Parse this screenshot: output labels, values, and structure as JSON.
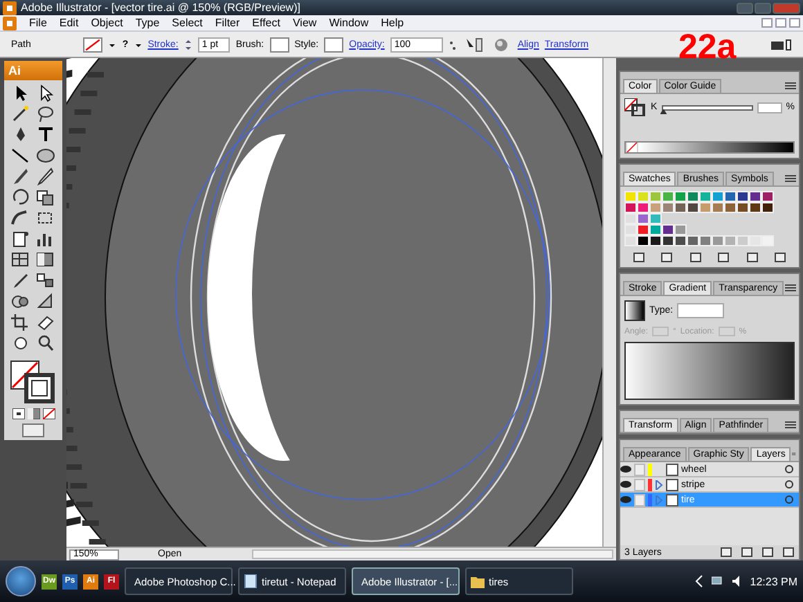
{
  "window": {
    "title": "Adobe Illustrator - [vector tire.ai @ 150% (RGB/Preview)]"
  },
  "menu": [
    "File",
    "Edit",
    "Object",
    "Type",
    "Select",
    "Filter",
    "Effect",
    "View",
    "Window",
    "Help"
  ],
  "control_bar": {
    "selection": "Path",
    "fill_glyph": "?",
    "stroke_label": "Stroke:",
    "stroke_weight": "1 pt",
    "brush_label": "Brush:",
    "style_label": "Style:",
    "opacity_label": "Opacity:",
    "opacity_value": "100",
    "links": [
      "Align",
      "Transform"
    ]
  },
  "overlay_label": "22a",
  "tools_panel": {
    "badge": "Ai"
  },
  "color_panel": {
    "tabs": [
      {
        "label": "Color",
        "selected": true
      },
      {
        "label": "Color Guide",
        "selected": false
      }
    ],
    "channel": "K",
    "level": 0,
    "unit": "%"
  },
  "swatches_panel": {
    "tabs": [
      {
        "label": "Swatches",
        "selected": true
      },
      {
        "label": "Brushes",
        "selected": false
      },
      {
        "label": "Symbols",
        "selected": false
      }
    ],
    "rows": [
      [
        {
          "color": "#f2e400"
        },
        {
          "color": "#d9e21c"
        },
        {
          "color": "#9cc63b"
        },
        {
          "color": "#4bb447"
        },
        {
          "color": "#13a14a"
        },
        {
          "color": "#0f8a5b"
        },
        {
          "color": "#17b29a"
        },
        {
          "color": "#14a0d0"
        },
        {
          "color": "#2467b1"
        },
        {
          "color": "#2b3990"
        },
        {
          "color": "#662d91"
        },
        {
          "color": "#9e1f63"
        }
      ],
      [
        {
          "color": "#d4145a"
        },
        {
          "color": "#ed1e79"
        },
        {
          "color": "#c7a27c"
        },
        {
          "color": "#9b8579"
        },
        {
          "color": "#736357"
        },
        {
          "color": "#534741"
        },
        {
          "color": "#c69c6d"
        },
        {
          "color": "#a67c52"
        },
        {
          "color": "#8c6239"
        },
        {
          "color": "#754c24"
        },
        {
          "color": "#603813"
        },
        {
          "color": "#42210b"
        }
      ],
      [
        {
          "color": "#e0e0e0"
        },
        {
          "color": "#9966cc"
        },
        {
          "color": "#33bbbb"
        }
      ],
      [
        {
          "color": "#e0e0e0"
        },
        {
          "color": "#ee1c25"
        },
        {
          "color": "#00a99d"
        },
        {
          "color": "#662d91"
        },
        {
          "color": "#999999"
        }
      ],
      [
        {
          "color": "#e0e0e0"
        },
        {
          "color": "#000000"
        },
        {
          "color": "#1a1a1a"
        },
        {
          "color": "#333333"
        },
        {
          "color": "#4d4d4d"
        },
        {
          "color": "#666666"
        },
        {
          "color": "#808080"
        },
        {
          "color": "#999999"
        },
        {
          "color": "#b3b3b3"
        },
        {
          "color": "#cccccc"
        },
        {
          "color": "#e6e6e6"
        },
        {
          "color": "#f2f2f2"
        }
      ]
    ]
  },
  "gradient_panel": {
    "tabs": [
      {
        "label": "Stroke",
        "selected": false
      },
      {
        "label": "Gradient",
        "selected": true
      },
      {
        "label": "Transparency",
        "selected": false
      }
    ],
    "type_label": "Type:",
    "angle_label": "Angle:",
    "angle_unit": "°",
    "location_label": "Location:",
    "location_unit": "%"
  },
  "transform_panel": {
    "tabs": [
      {
        "label": "Transform",
        "selected": true
      },
      {
        "label": "Align",
        "selected": false
      },
      {
        "label": "Pathfinder",
        "selected": false
      }
    ]
  },
  "layers_panel": {
    "tabs": [
      {
        "label": "Appearance",
        "selected": false
      },
      {
        "label": "Graphic Sty",
        "selected": false
      },
      {
        "label": "Layers",
        "selected": true
      }
    ],
    "layers": [
      {
        "name": "wheel",
        "color": "#ffff00",
        "expandable": false,
        "selected": false
      },
      {
        "name": "stripe",
        "color": "#ff3333",
        "expandable": true,
        "selected": false
      },
      {
        "name": "tire",
        "color": "#3366ff",
        "expandable": true,
        "selected": true
      }
    ],
    "footer": "3 Layers"
  },
  "status_bar": {
    "zoom": "150%",
    "status": "Open"
  },
  "taskbar": {
    "quick_launch": [
      {
        "label": "Dw",
        "color": "#6a9a1f"
      },
      {
        "label": "Ps",
        "color": "#1f5fae"
      },
      {
        "label": "Ai",
        "color": "#e07b10"
      },
      {
        "label": "Fl",
        "color": "#b3141c"
      }
    ],
    "tasks": [
      {
        "label": "Adobe Photoshop C...",
        "kind": "ps",
        "selected": false
      },
      {
        "label": "tiretut - Notepad",
        "kind": "notepad",
        "selected": false
      },
      {
        "label": "Adobe Illustrator - [...",
        "kind": "ai",
        "selected": true
      },
      {
        "label": "tires",
        "kind": "folder",
        "selected": false
      }
    ],
    "clock": "12:23 PM"
  }
}
